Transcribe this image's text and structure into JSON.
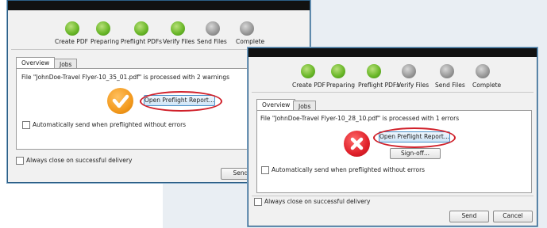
{
  "steps": [
    "Create PDF",
    "Preparing",
    "Preflight PDFs",
    "Verify Files",
    "Send Files",
    "Complete"
  ],
  "window1": {
    "tabs": [
      "Overview",
      "Jobs"
    ],
    "status": "File \"JohnDoe-Travel Flyer-10_35_01.pdf\" is processed with 2 warnings",
    "report_button": "Open Preflight Report...",
    "auto_send_label": "Automatically send when preflighted without errors",
    "always_close_label": "Always close on successful delivery",
    "send_button": "Send"
  },
  "window2": {
    "tabs": [
      "Overview",
      "Jobs"
    ],
    "status": "File \"JohnDoe-Travel Flyer-10_28_10.pdf\" is processed with 1 errors",
    "report_button": "Open Preflight Report...",
    "signoff_button": "Sign-off...",
    "auto_send_label": "Automatically send when preflighted without errors",
    "always_close_label": "Always close on successful delivery",
    "send_button": "Send",
    "cancel_button": "Cancel"
  },
  "colors": {
    "warning": "#f39a1e",
    "error": "#e0202a",
    "step_done": "#6cb82a",
    "step_pending": "#9a9a9a",
    "highlight_ring": "#d0202a"
  }
}
